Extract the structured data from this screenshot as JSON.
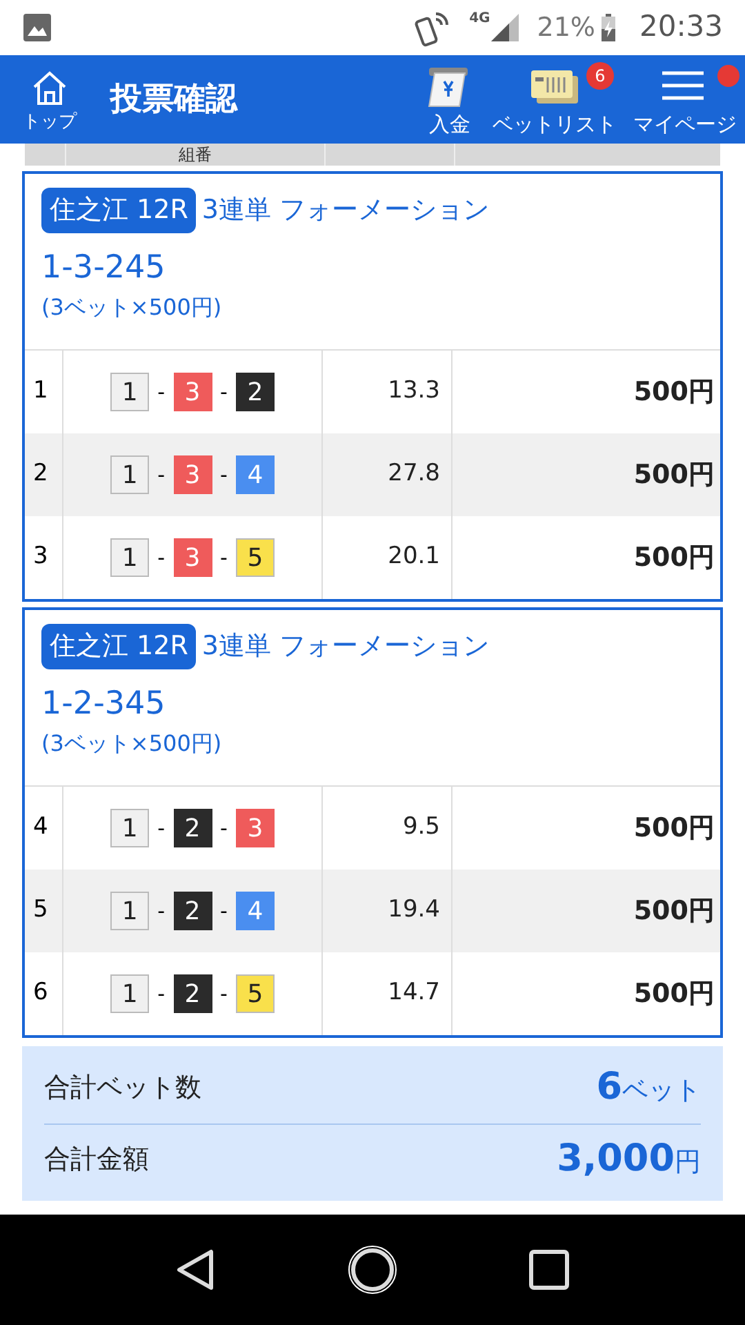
{
  "status_bar": {
    "network": "4G",
    "battery": "21%",
    "time": "20:33"
  },
  "app_bar": {
    "home_label": "トップ",
    "title": "投票確認",
    "actions": [
      {
        "kind": "deposit",
        "label": "入金"
      },
      {
        "kind": "betlist",
        "label": "ベットリスト",
        "badge": "6"
      },
      {
        "kind": "mypage",
        "label": "マイページ",
        "dot": true
      }
    ]
  },
  "table_header": {
    "columns": [
      "組番"
    ]
  },
  "bets": [
    {
      "venue": "住之江 12R",
      "bet_type": "3連単 フォーメーション",
      "combination": "1-3-245",
      "summary": "(3ベット×500円)",
      "rows": [
        {
          "no": "1",
          "boats": [
            {
              "number": "1",
              "color": "#f0f0f0"
            },
            {
              "number": "3",
              "color": "#ef5b5b"
            },
            {
              "number": "2",
              "color": "#2b2b2b"
            }
          ],
          "separators": [
            "-",
            "-"
          ],
          "odds": "13.3",
          "amount": "500円"
        },
        {
          "no": "2",
          "boats": [
            {
              "number": "1",
              "color": "#f0f0f0"
            },
            {
              "number": "3",
              "color": "#ef5b5b"
            },
            {
              "number": "4",
              "color": "#4a8ef0"
            }
          ],
          "separators": [
            "-",
            "-"
          ],
          "odds": "27.8",
          "amount": "500円"
        },
        {
          "no": "3",
          "boats": [
            {
              "number": "1",
              "color": "#f0f0f0"
            },
            {
              "number": "3",
              "color": "#ef5b5b"
            },
            {
              "number": "5",
              "color": "#f9e04b"
            }
          ],
          "separators": [
            "-",
            "-"
          ],
          "odds": "20.1",
          "amount": "500円"
        }
      ]
    },
    {
      "venue": "住之江 12R",
      "bet_type": "3連単 フォーメーション",
      "combination": "1-2-345",
      "summary": "(3ベット×500円)",
      "rows": [
        {
          "no": "4",
          "boats": [
            {
              "number": "1",
              "color": "#f0f0f0"
            },
            {
              "number": "2",
              "color": "#2b2b2b"
            },
            {
              "number": "3",
              "color": "#ef5b5b"
            }
          ],
          "separators": [
            "-",
            "-"
          ],
          "odds": "9.5",
          "amount": "500円"
        },
        {
          "no": "5",
          "boats": [
            {
              "number": "1",
              "color": "#f0f0f0"
            },
            {
              "number": "2",
              "color": "#2b2b2b"
            },
            {
              "number": "4",
              "color": "#4a8ef0"
            }
          ],
          "separators": [
            "-",
            "-"
          ],
          "odds": "19.4",
          "amount": "500円"
        },
        {
          "no": "6",
          "boats": [
            {
              "number": "1",
              "color": "#f0f0f0"
            },
            {
              "number": "2",
              "color": "#2b2b2b"
            },
            {
              "number": "5",
              "color": "#f9e04b"
            }
          ],
          "separators": [
            "-",
            "-"
          ],
          "odds": "14.7",
          "amount": "500円"
        }
      ]
    }
  ],
  "totals": [
    {
      "label": "合計ベット数",
      "value": "6",
      "unit": "ベット"
    },
    {
      "label": "合計金額",
      "value": "3,000",
      "unit": "円"
    }
  ]
}
